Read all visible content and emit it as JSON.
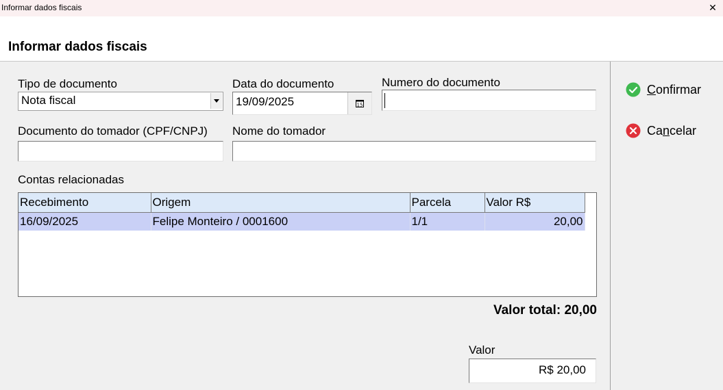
{
  "window": {
    "title": "Informar dados fiscais",
    "close_glyph": "✕"
  },
  "header": {
    "title": "Informar dados fiscais"
  },
  "form": {
    "tipo_label": "Tipo de documento",
    "tipo_value": "Nota fiscal",
    "data_label": "Data do documento",
    "data_value": "19/09/2025",
    "calendar_icon_text": "15",
    "numero_label": "Numero do documento",
    "numero_value": "",
    "doc_tomador_label": "Documento do tomador (CPF/CNPJ)",
    "doc_tomador_value": "",
    "nome_tomador_label": "Nome do tomador",
    "nome_tomador_value": ""
  },
  "contas": {
    "label": "Contas relacionadas",
    "columns": [
      "Recebimento",
      "Origem",
      "Parcela",
      "Valor R$"
    ],
    "rows": [
      [
        "16/09/2025",
        "Felipe Monteiro / 0001600",
        "1/1",
        "20,00"
      ]
    ]
  },
  "total": "Valor total: 20,00",
  "valor": {
    "label": "Valor",
    "value": "R$ 20,00"
  },
  "actions": {
    "confirm_first": "C",
    "confirm_rest": "onfirmar",
    "cancel_first": "Ca",
    "cancel_underlined": "n",
    "cancel_rest": "celar"
  },
  "colors": {
    "confirm": "#3fb950",
    "cancel": "#e0323a",
    "grid_header": "#dce9f9",
    "grid_selected_row": "#c9d0f6"
  },
  "icons": {
    "confirm": "check-circle-icon",
    "cancel": "x-circle-icon",
    "calendar": "calendar-icon",
    "dropdown": "chevron-down-icon",
    "close": "close-icon"
  }
}
